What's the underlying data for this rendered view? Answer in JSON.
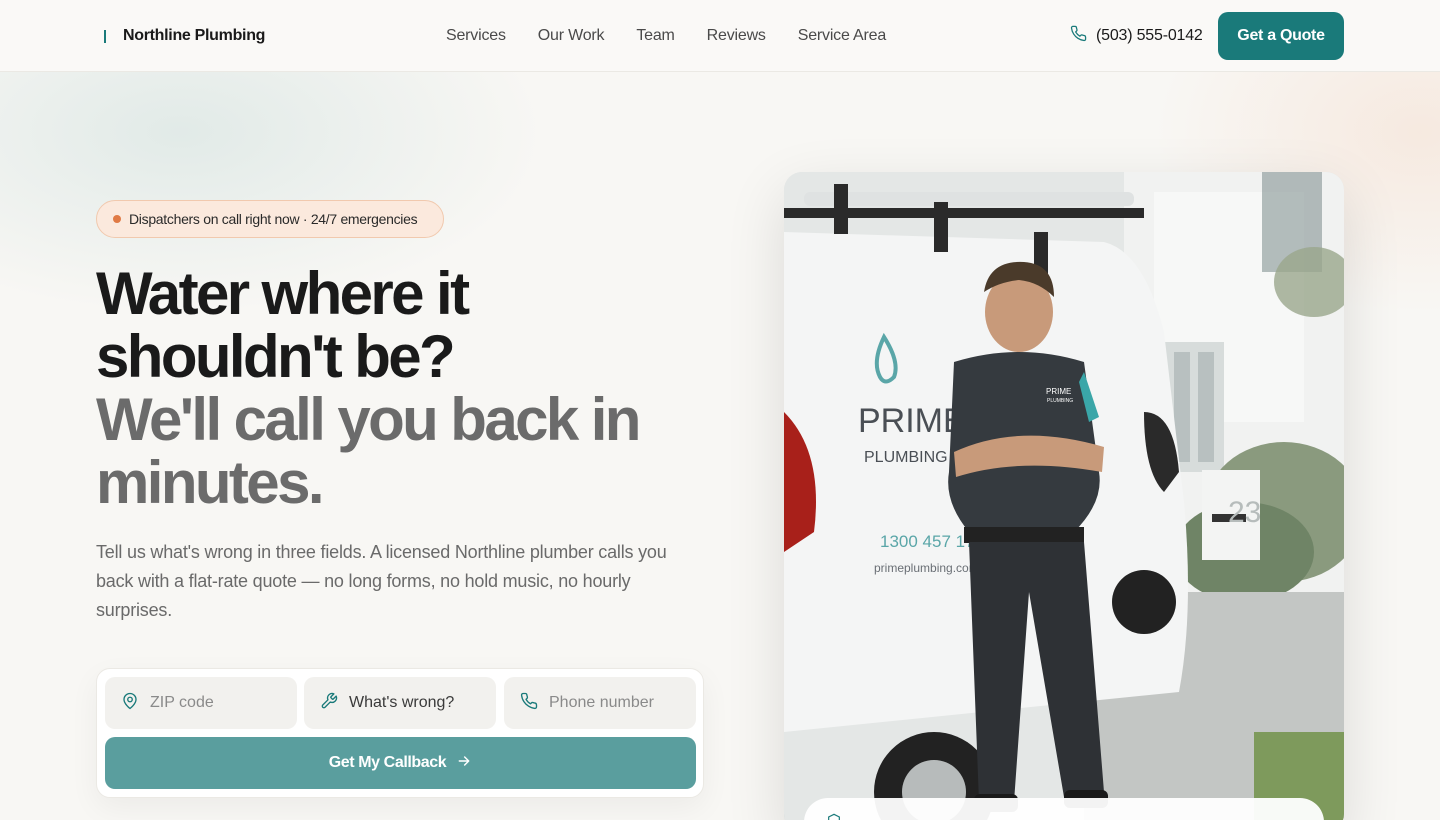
{
  "header": {
    "brand": "Northline Plumbing",
    "nav": [
      "Services",
      "Our Work",
      "Team",
      "Reviews",
      "Service Area"
    ],
    "phone": "(503) 555-0142",
    "cta_label": "Get a Quote"
  },
  "hero": {
    "badge": "Dispatchers on call right now · 24/7 emergencies",
    "headline_dark": [
      "Water where it",
      "shouldn't be?"
    ],
    "headline_grey": [
      "We'll call you back in",
      "minutes."
    ],
    "subtext": "Tell us what's wrong in three fields. A licensed Northline plumber calls you back with a flat-rate quote — no long forms, no hold music, no hourly surprises.",
    "form": {
      "zip_placeholder": "ZIP code",
      "issue_value": "What's wrong?",
      "phone_placeholder": "Phone number",
      "submit_label": "Get My Callback"
    },
    "image_van": {
      "brand_top": "PRIME",
      "brand_bottom": "PLUMBING",
      "van_phone": "1300 457 174",
      "van_url": "primeplumbing.com.au",
      "shirt_logo_top": "PRIME",
      "shirt_logo_bottom": "PLUMBING",
      "house_number": "23"
    }
  },
  "colors": {
    "accent": "#1a7a7a",
    "accent_soft": "#5a9e9e",
    "badge_bg": "#fbe9dd",
    "badge_dot": "#e07a45"
  },
  "icons": {
    "phone": "phone-icon",
    "zip": "map-pin-icon",
    "issue": "wrench-icon",
    "phone_field": "phone-icon",
    "submit_arrow": "arrow-right-icon",
    "shield": "shield-icon"
  }
}
